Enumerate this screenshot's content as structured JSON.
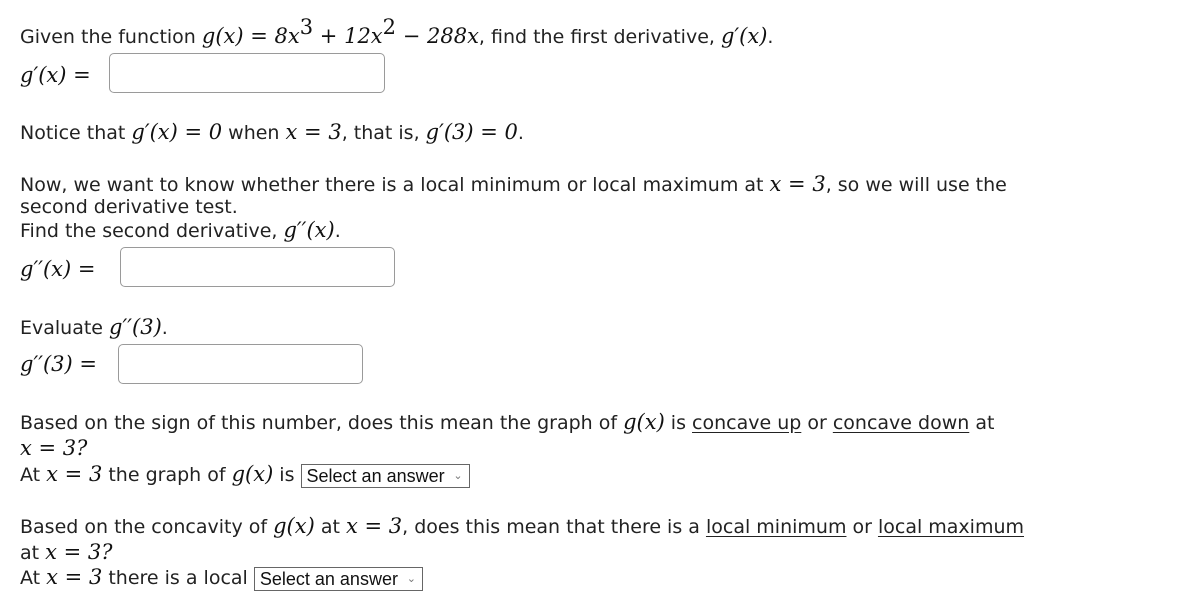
{
  "q1": {
    "prefix": "Given the function ",
    "func_lhs": "g(x)",
    "eq": " = ",
    "t1": "8x",
    "t1_exp": "3",
    "plus": " + ",
    "t2": "12x",
    "t2_exp": "2",
    "minus": " − ",
    "t3": "288x",
    "mid": ", find the first derivative, ",
    "gp": "g′(x)",
    "end": ".",
    "input_label": "g′(x) =",
    "input_value": ""
  },
  "q2": {
    "a": "Notice that ",
    "m1": "g′(x) = 0",
    "b": " when ",
    "m2": "x = 3",
    "c": ", that is, ",
    "m3": "g′(3) = 0",
    "d": "."
  },
  "q3": {
    "line1a": "Now, we want to know whether there is a local minimum or local maximum at ",
    "line1m": "x = 3",
    "line1b": ", so we will use the",
    "line2": "second derivative test.",
    "line3a": "Find the second derivative, ",
    "line3m": "g′′(x)",
    "line3b": ".",
    "input_label": "g′′(x) =",
    "input_value": ""
  },
  "q4": {
    "a": "Evaluate ",
    "m": "g′′(3)",
    "b": ".",
    "input_label": "g′′(3) =",
    "input_value": ""
  },
  "q5": {
    "a": "Based on the sign of this number, does this mean the graph of ",
    "m1": "g(x)",
    "b": " is ",
    "link1": "concave up",
    "c": " or ",
    "link2": "concave down",
    "d": " at",
    "line2m": "x = 3?",
    "line3a": "At ",
    "line3m1": "x = 3",
    "line3b": " the graph of ",
    "line3m2": "g(x)",
    "line3c": " is ",
    "select": "Select an answer"
  },
  "q6": {
    "a": "Based on the concavity of ",
    "m1": "g(x)",
    "b": " at ",
    "m2": "x = 3",
    "c": ", does this mean that there is a ",
    "link1": "local minimum",
    "d": " or ",
    "link2": "local maximum",
    "line2a": "at ",
    "line2m": "x = 3?",
    "line3a": "At ",
    "line3m": "x = 3",
    "line3b": " there is a local ",
    "select": "Select an answer"
  },
  "icons": {
    "select_chevron": "⌄"
  }
}
